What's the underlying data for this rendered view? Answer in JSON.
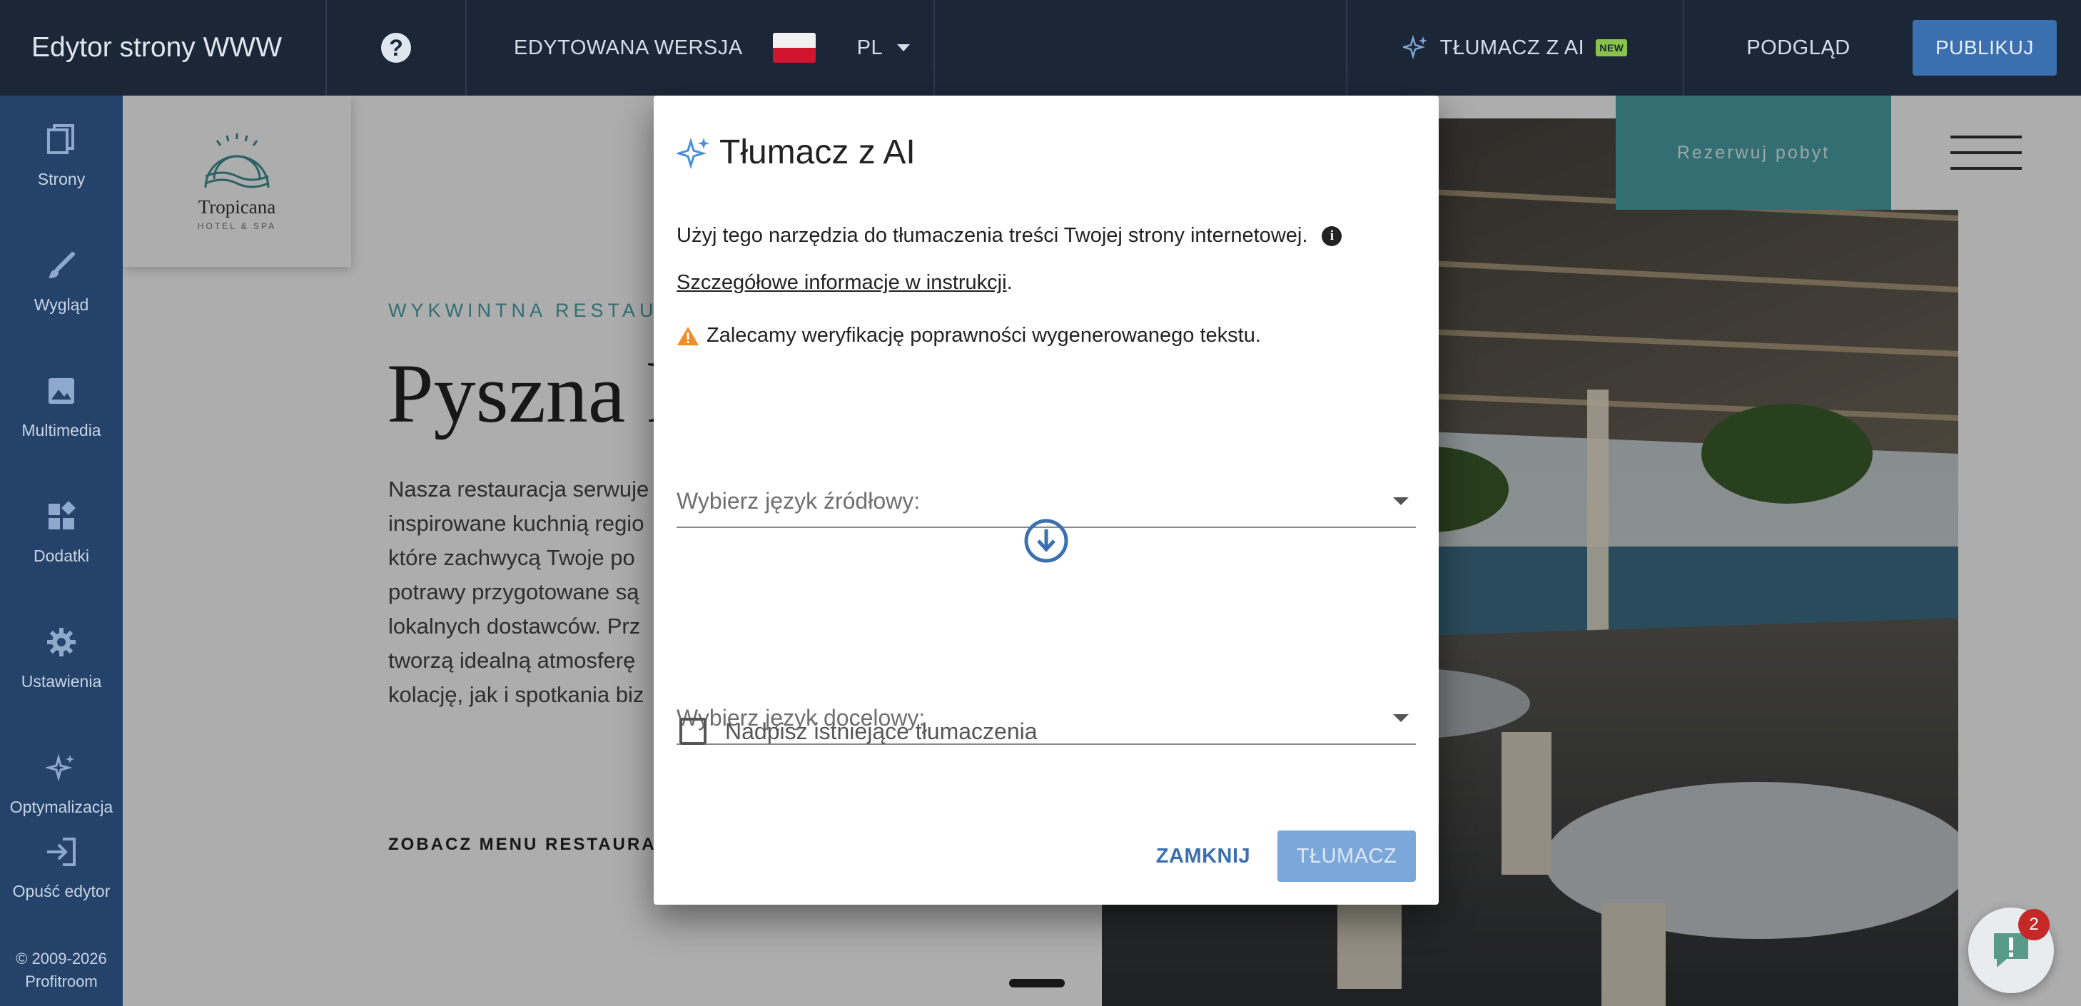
{
  "topbar": {
    "title": "Edytor strony WWW",
    "version_label": "EDYTOWANA WERSJA",
    "language": "PL",
    "ai_translate_label": "TŁUMACZ Z AI",
    "new_badge": "NEW",
    "preview_label": "PODGLĄD",
    "publish_label": "PUBLIKUJ"
  },
  "sidebar": {
    "items": [
      {
        "label": "Strony",
        "icon": "pages-icon"
      },
      {
        "label": "Wygląd",
        "icon": "brush-icon"
      },
      {
        "label": "Multimedia",
        "icon": "image-icon"
      },
      {
        "label": "Dodatki",
        "icon": "widgets-icon"
      },
      {
        "label": "Ustawienia",
        "icon": "gear-icon"
      },
      {
        "label": "Optymalizacja",
        "icon": "sparkle-icon"
      },
      {
        "label": "Opuść edytor",
        "icon": "exit-icon"
      }
    ],
    "copyright": "© 2009-2026",
    "brand": "Profitroom"
  },
  "site": {
    "logo_name": "Tropicana",
    "logo_sub": "HOTEL & SPA",
    "kicker": "WYKWINTNA RESTAURACJA",
    "headline": "Pyszna k",
    "body_lines": [
      "Nasza restauracja serwuje",
      "inspirowane kuchnią regio",
      "które zachwycą Twoje po",
      "potrawy przygotowane są",
      "lokalnych dostawców. Prz",
      "tworzą idealną atmosferę",
      "kolację, jak i spotkania biz"
    ],
    "menu_link": "ZOBACZ MENU RESTAURACJI",
    "book_button": "Rezerwuj pobyt"
  },
  "modal": {
    "title": "Tłumacz z AI",
    "description": "Użyj tego narzędzia do tłumaczenia treści Twojej strony internetowej.",
    "instructions_link": "Szczegółowe informacje w instrukcji",
    "instructions_suffix": ".",
    "warning": "Zalecamy weryfikację poprawności wygenerowanego tekstu.",
    "source_placeholder": "Wybierz język źródłowy:",
    "target_placeholder": "Wybierz język docelowy:",
    "overwrite_label": "Nadpisz istniejące tłumaczenia",
    "overwrite_checked": false,
    "close_button": "ZAMKNIJ",
    "translate_button": "TŁUMACZ"
  },
  "chat": {
    "unread_count": "2"
  },
  "colors": {
    "topbar_bg": "#1b2737",
    "sidebar_bg": "#25426a",
    "accent": "#3a6fb0",
    "teal": "#4aa3a8",
    "warning": "#f28c28"
  }
}
